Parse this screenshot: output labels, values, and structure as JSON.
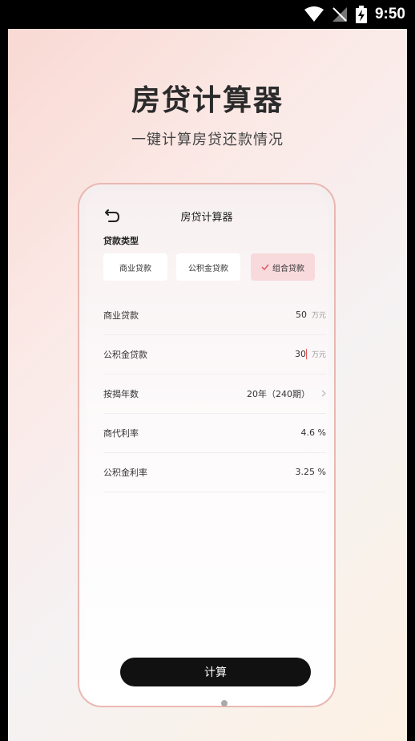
{
  "status": {
    "time": "9:50"
  },
  "hero": {
    "title": "房贷计算器",
    "subtitle": "一键计算房贷还款情况"
  },
  "app": {
    "title": "房贷计算器",
    "loan_type_label": "贷款类型",
    "loan_types": [
      {
        "label": "商业贷款",
        "selected": false
      },
      {
        "label": "公积金贷款",
        "selected": false
      },
      {
        "label": "组合贷款",
        "selected": true
      }
    ],
    "rows": [
      {
        "label": "商业贷款",
        "value": "50",
        "unit": "万元"
      },
      {
        "label": "公积金贷款",
        "value": "30",
        "unit": "万元"
      },
      {
        "label": "按揭年数",
        "value": "20年（240期）"
      },
      {
        "label": "商代利率",
        "value": "4.6 %"
      },
      {
        "label": "公积金利率",
        "value": "3.25 %"
      }
    ],
    "calculate_label": "计算"
  },
  "colors": {
    "accent_selected": "#f8dadd",
    "button": "#111111",
    "frame_border": "#e9b8b2"
  }
}
